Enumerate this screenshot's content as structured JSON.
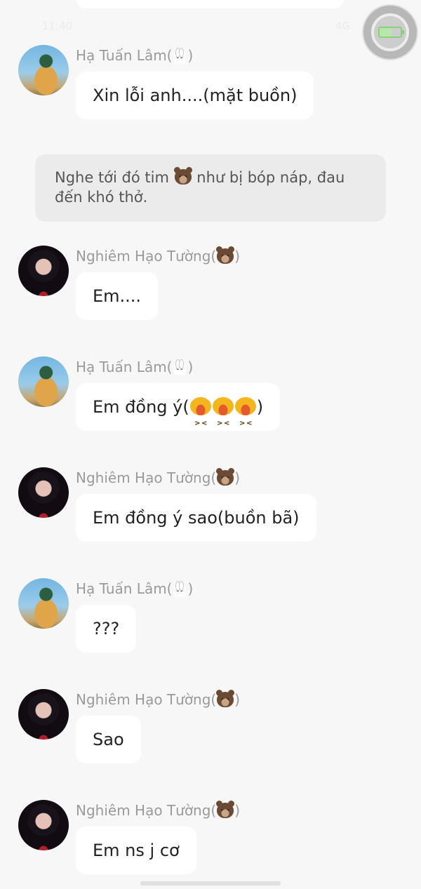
{
  "status_bar": {
    "left_text": "11:40",
    "right_text": "4G"
  },
  "messages": [
    {
      "type": "chat",
      "avatar": "lam",
      "name": "Hạ Tuấn Lâm(",
      "name_suffix": ")",
      "icon": "rabbit-icon",
      "text": "Xin lỗi anh....(mặt buồn)"
    },
    {
      "type": "narration",
      "text_before": "Nghe tới đó tim ",
      "text_after": " như bị bóp náp, đau đến khó thở.",
      "icon": "bear-icon"
    },
    {
      "type": "chat",
      "avatar": "tuong",
      "name": "Nghiêm Hạo Tường(",
      "name_suffix": ")",
      "icon": "bear-icon",
      "text": "Em...."
    },
    {
      "type": "chat",
      "avatar": "lam",
      "name": "Hạ Tuấn Lâm(",
      "name_suffix": ")",
      "icon": "rabbit-icon",
      "text_before": "Em đồng ý(",
      "text_after": ")",
      "emoji": "laughing-emoji",
      "emoji_count": 3
    },
    {
      "type": "chat",
      "avatar": "tuong",
      "name": "Nghiêm Hạo Tường(",
      "name_suffix": ")",
      "icon": "bear-icon",
      "text": "Em đồng ý sao(buồn bã)"
    },
    {
      "type": "chat",
      "avatar": "lam",
      "name": "Hạ Tuấn Lâm(",
      "name_suffix": ")",
      "icon": "rabbit-icon",
      "text": "???"
    },
    {
      "type": "chat",
      "avatar": "tuong",
      "name": "Nghiêm Hạo Tường(",
      "name_suffix": ")",
      "icon": "bear-icon",
      "text": "Sao"
    },
    {
      "type": "chat",
      "avatar": "tuong",
      "name": "Nghiêm Hạo Tường(",
      "name_suffix": ")",
      "icon": "bear-icon",
      "text": "Em ns j cơ"
    }
  ]
}
